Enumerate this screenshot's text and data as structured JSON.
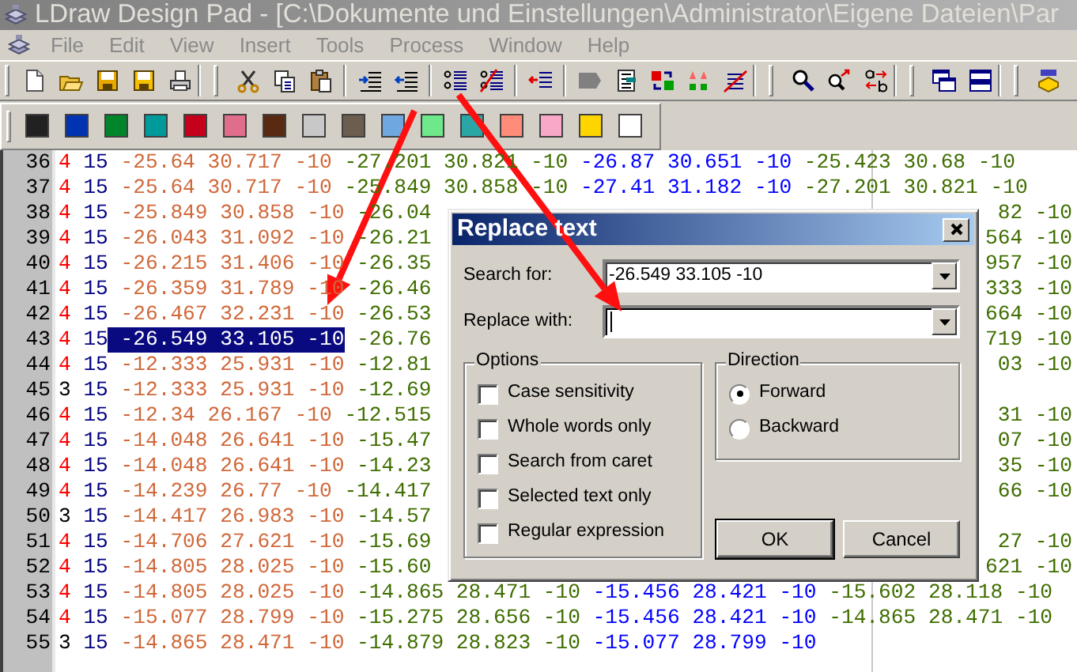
{
  "window": {
    "title": "LDraw Design Pad - [C:\\Dokumente und Einstellungen\\Administrator\\Eigene Dateien\\Par"
  },
  "menu": [
    {
      "label": "File",
      "disabled": true
    },
    {
      "label": "Edit",
      "disabled": true
    },
    {
      "label": "View",
      "disabled": true
    },
    {
      "label": "Insert",
      "disabled": true
    },
    {
      "label": "Tools",
      "disabled": true
    },
    {
      "label": "Process",
      "disabled": true
    },
    {
      "label": "Window",
      "disabled": true
    },
    {
      "label": "Help",
      "disabled": true
    }
  ],
  "color_palette": [
    {
      "color": "#212121"
    },
    {
      "color": "#0033b2"
    },
    {
      "color": "#00852b"
    },
    {
      "color": "#009a9a"
    },
    {
      "color": "#c4001a"
    },
    {
      "color": "#e06d8a"
    },
    {
      "color": "#582a12"
    },
    {
      "color": "#c8c8c8"
    },
    {
      "color": "#6b5e4e"
    },
    {
      "color": "#6fa7e0"
    },
    {
      "color": "#6ee88a"
    },
    {
      "color": "#2aa6a6"
    },
    {
      "color": "#ff8c7a"
    },
    {
      "color": "#f9a8c8"
    },
    {
      "color": "#ffd500"
    },
    {
      "color": "#ffffff"
    }
  ],
  "editor": {
    "lines": [
      {
        "number": "36",
        "parts": [
          {
            "text": "4",
            "kind": "quad"
          },
          {
            "text": "15",
            "kind": "color"
          },
          {
            "text": "-25.64 30.717 -10",
            "kind": "pointa"
          },
          {
            "text": "-27.201 30.821 -10",
            "kind": "pointb"
          },
          {
            "text": "-26.87 30.651 -10",
            "kind": "pointc"
          },
          {
            "text": "-25.423 30.68 -10",
            "kind": "pointd"
          }
        ]
      },
      {
        "number": "37",
        "parts": [
          {
            "text": "4",
            "kind": "quad"
          },
          {
            "text": "15",
            "kind": "color"
          },
          {
            "text": "-25.64 30.717 -10",
            "kind": "pointa"
          },
          {
            "text": "-25.849 30.858 -10",
            "kind": "pointb"
          },
          {
            "text": "-27.41 31.182 -10",
            "kind": "pointc"
          },
          {
            "text": "-27.201 30.821 -10",
            "kind": "pointd"
          }
        ]
      },
      {
        "number": "38",
        "parts": [
          {
            "text": "4",
            "kind": "quad"
          },
          {
            "text": "15",
            "kind": "color"
          },
          {
            "text": "-25.849 30.858 -10",
            "kind": "pointa"
          },
          {
            "text": "-26.04",
            "kind": "pointb"
          }
        ],
        "tail": {
          "text": "82 -10",
          "kind": "pointd"
        }
      },
      {
        "number": "39",
        "parts": [
          {
            "text": "4",
            "kind": "quad"
          },
          {
            "text": "15",
            "kind": "color"
          },
          {
            "text": "-26.043 31.092 -10",
            "kind": "pointa"
          },
          {
            "text": "-26.21",
            "kind": "pointb"
          }
        ],
        "tail": {
          "text": "564 -10",
          "kind": "pointd"
        }
      },
      {
        "number": "40",
        "parts": [
          {
            "text": "4",
            "kind": "quad"
          },
          {
            "text": "15",
            "kind": "color"
          },
          {
            "text": "-26.215 31.406 -10",
            "kind": "pointa"
          },
          {
            "text": "-26.35",
            "kind": "pointb"
          }
        ],
        "tail": {
          "text": "957 -10",
          "kind": "pointd"
        }
      },
      {
        "number": "41",
        "parts": [
          {
            "text": "4",
            "kind": "quad"
          },
          {
            "text": "15",
            "kind": "color"
          },
          {
            "text": "-26.359 31.789 -10",
            "kind": "pointa"
          },
          {
            "text": "-26.46",
            "kind": "pointb"
          }
        ],
        "tail": {
          "text": "333 -10",
          "kind": "pointd"
        }
      },
      {
        "number": "42",
        "parts": [
          {
            "text": "4",
            "kind": "quad"
          },
          {
            "text": "15",
            "kind": "color"
          },
          {
            "text": "-26.467 32.231 -10",
            "kind": "pointa"
          },
          {
            "text": "-26.53",
            "kind": "pointb"
          }
        ],
        "tail": {
          "text": "664 -10",
          "kind": "pointd"
        }
      },
      {
        "number": "43",
        "parts": [
          {
            "text": "4",
            "kind": "quad"
          },
          {
            "text": "15",
            "kind": "color"
          },
          {
            "text": "-26.549 33.105 -10",
            "kind": "selection"
          },
          {
            "text": "-26.76",
            "kind": "pointb"
          }
        ],
        "tail": {
          "text": "719 -10",
          "kind": "pointd"
        }
      },
      {
        "number": "44",
        "parts": [
          {
            "text": "4",
            "kind": "quad"
          },
          {
            "text": "15",
            "kind": "color"
          },
          {
            "text": "-12.333 25.931 -10",
            "kind": "pointa"
          },
          {
            "text": "-12.81",
            "kind": "pointb"
          }
        ],
        "tail": {
          "text": "03 -10",
          "kind": "pointd"
        }
      },
      {
        "number": "45",
        "parts": [
          {
            "text": "3",
            "kind": "triangle"
          },
          {
            "text": "15",
            "kind": "color"
          },
          {
            "text": "-12.333 25.931 -10",
            "kind": "pointa"
          },
          {
            "text": "-12.69",
            "kind": "pointb"
          }
        ]
      },
      {
        "number": "46",
        "parts": [
          {
            "text": "4",
            "kind": "quad"
          },
          {
            "text": "15",
            "kind": "color"
          },
          {
            "text": "-12.34 26.167 -10",
            "kind": "pointa"
          },
          {
            "text": "-12.515",
            "kind": "pointb"
          }
        ],
        "tail": {
          "text": "31 -10",
          "kind": "pointd"
        }
      },
      {
        "number": "47",
        "parts": [
          {
            "text": "4",
            "kind": "quad"
          },
          {
            "text": "15",
            "kind": "color"
          },
          {
            "text": "-14.048 26.641 -10",
            "kind": "pointa"
          },
          {
            "text": "-15.47",
            "kind": "pointb"
          }
        ],
        "tail": {
          "text": "07 -10",
          "kind": "pointd"
        }
      },
      {
        "number": "48",
        "parts": [
          {
            "text": "4",
            "kind": "quad"
          },
          {
            "text": "15",
            "kind": "color"
          },
          {
            "text": "-14.048 26.641 -10",
            "kind": "pointa"
          },
          {
            "text": "-14.23",
            "kind": "pointb"
          }
        ],
        "tail": {
          "text": "35 -10",
          "kind": "pointd"
        }
      },
      {
        "number": "49",
        "parts": [
          {
            "text": "4",
            "kind": "quad"
          },
          {
            "text": "15",
            "kind": "color"
          },
          {
            "text": "-14.239 26.77 -10",
            "kind": "pointa"
          },
          {
            "text": "-14.417",
            "kind": "pointb"
          }
        ],
        "tail": {
          "text": "66 -10",
          "kind": "pointd"
        }
      },
      {
        "number": "50",
        "parts": [
          {
            "text": "3",
            "kind": "triangle"
          },
          {
            "text": "15",
            "kind": "color"
          },
          {
            "text": "-14.417 26.983 -10",
            "kind": "pointa"
          },
          {
            "text": "-14.57",
            "kind": "pointb"
          }
        ]
      },
      {
        "number": "51",
        "parts": [
          {
            "text": "4",
            "kind": "quad"
          },
          {
            "text": "15",
            "kind": "color"
          },
          {
            "text": "-14.706 27.621 -10",
            "kind": "pointa"
          },
          {
            "text": "-15.69",
            "kind": "pointb"
          }
        ],
        "tail": {
          "text": "27 -10",
          "kind": "pointd"
        }
      },
      {
        "number": "52",
        "parts": [
          {
            "text": "4",
            "kind": "quad"
          },
          {
            "text": "15",
            "kind": "color"
          },
          {
            "text": "-14.805 28.025 -10",
            "kind": "pointa"
          },
          {
            "text": "-15.60",
            "kind": "pointb"
          }
        ],
        "tail": {
          "text": "621 -10",
          "kind": "pointd"
        }
      },
      {
        "number": "53",
        "parts": [
          {
            "text": "4",
            "kind": "quad"
          },
          {
            "text": "15",
            "kind": "color"
          },
          {
            "text": "-14.805 28.025 -10",
            "kind": "pointa"
          },
          {
            "text": "-14.865 28.471 -10",
            "kind": "pointb"
          },
          {
            "text": "-15.456 28.421 -10",
            "kind": "pointc"
          },
          {
            "text": "-15.602 28.118 -10",
            "kind": "pointd"
          }
        ]
      },
      {
        "number": "54",
        "parts": [
          {
            "text": "4",
            "kind": "quad"
          },
          {
            "text": "15",
            "kind": "color"
          },
          {
            "text": "-15.077 28.799 -10",
            "kind": "pointa"
          },
          {
            "text": "-15.275 28.656 -10",
            "kind": "pointb"
          },
          {
            "text": "-15.456 28.421 -10",
            "kind": "pointc"
          },
          {
            "text": "-14.865 28.471 -10",
            "kind": "pointd"
          }
        ]
      },
      {
        "number": "55",
        "parts": [
          {
            "text": "3",
            "kind": "triangle"
          },
          {
            "text": "15",
            "kind": "color"
          },
          {
            "text": "-14.865 28.471 -10",
            "kind": "pointa"
          },
          {
            "text": "-14.879 28.823 -10",
            "kind": "pointb"
          },
          {
            "text": "-15.077 28.799 -10",
            "kind": "pointc"
          }
        ]
      }
    ]
  },
  "dialog": {
    "title": "Replace text",
    "fields": [
      {
        "label": "Search for:",
        "value": "-26.549 33.105 -10",
        "focused": false
      },
      {
        "label": "Replace with:",
        "focused": true
      }
    ],
    "options": {
      "title": "Options",
      "items": [
        {
          "label": "Case sensitivity",
          "checked": false
        },
        {
          "label": "Whole words only",
          "checked": false
        },
        {
          "label": "Search from caret",
          "checked": false
        },
        {
          "label": "Selected text only",
          "checked": false
        },
        {
          "label": "Regular expression",
          "checked": false
        }
      ]
    },
    "direction": {
      "title": "Direction",
      "items": [
        {
          "label": "Forward",
          "selected": true
        },
        {
          "label": "Backward",
          "selected": false
        }
      ]
    },
    "buttons": [
      {
        "label": "OK",
        "default": true
      },
      {
        "label": "Cancel",
        "default": false
      }
    ]
  }
}
